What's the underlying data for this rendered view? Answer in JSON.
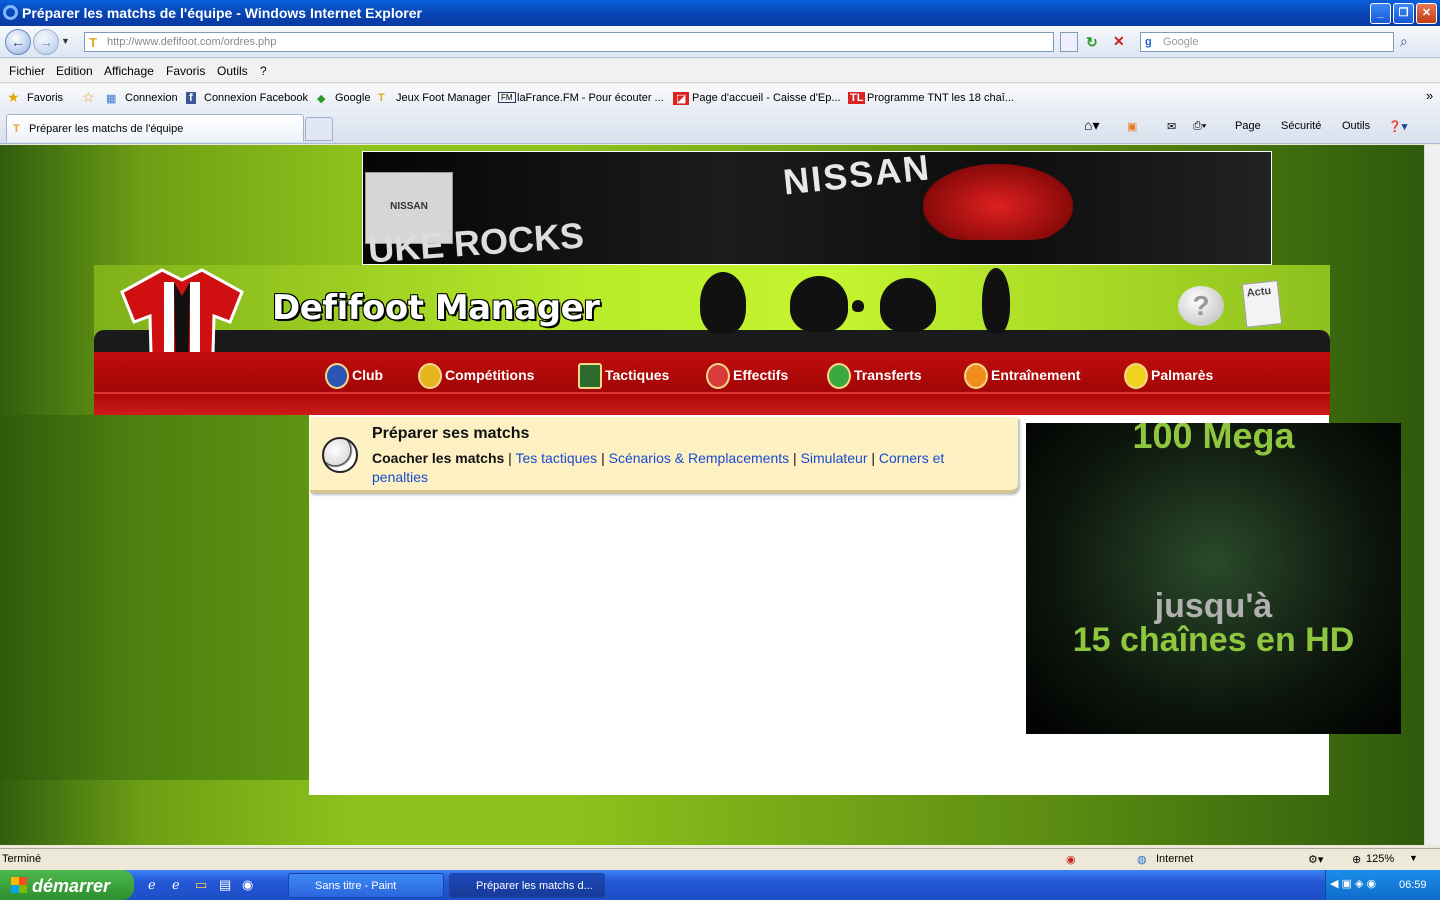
{
  "window": {
    "title": "Préparer les matchs de l'équipe - Windows Internet Explorer"
  },
  "browser": {
    "address": "http://www.defifoot.com/ordres.php",
    "search_placeholder": "Google",
    "menu": [
      "Fichier",
      "Edition",
      "Affichage",
      "Favoris",
      "Outils",
      "?"
    ],
    "favorites_label": "Favoris",
    "favorites": [
      "Connexion",
      "Connexion  Facebook",
      "Google",
      "Jeux Foot Manager",
      "laFrance.FM - Pour écouter ...",
      "Page d'accueil - Caisse d'Ep...",
      "Programme TNT  les 18 chaî..."
    ],
    "tab_title": "Préparer les matchs de l'équipe",
    "commands": [
      "Page",
      "Sécurité",
      "Outils"
    ]
  },
  "banner": {
    "brand": "NISSAN",
    "logo_text": "NISSAN",
    "slogan": "UKE ROCKS"
  },
  "site": {
    "logo_text": "Defifoot Manager",
    "actu_label": "Actu",
    "help_label": "?",
    "nav": [
      {
        "label": "Club",
        "color": "#2b55b5"
      },
      {
        "label": "Compétitions",
        "color": "#e6b51e"
      },
      {
        "label": "Tactiques",
        "color": "#2d6b2d"
      },
      {
        "label": "Effectifs",
        "color": "#d93a3a"
      },
      {
        "label": "Transferts",
        "color": "#3da83d"
      },
      {
        "label": "Entraînement",
        "color": "#f08c1e"
      },
      {
        "label": "Palmarès",
        "color": "#f0d21e"
      }
    ]
  },
  "subnav": {
    "title": "Préparer ses matchs",
    "current": "Coacher les matchs",
    "links": [
      "Tes tactiques",
      "Scénarios & Remplacements",
      "Simulateur",
      "Corners et penalties"
    ]
  },
  "ad": {
    "line1": "100 Mega",
    "line2": "jusqu'à",
    "line3": "15 chaînes en HD"
  },
  "status": {
    "text": "Terminé",
    "zone": "Internet",
    "zoom": "125%"
  },
  "taskbar": {
    "start": "démarrer",
    "tasks": [
      "Sans titre - Paint",
      "Préparer les matchs d..."
    ],
    "clock": "06:59"
  },
  "colors": {
    "accent_green": "#8dc21c",
    "nav_red": "#c20d0d",
    "link_blue": "#1a4bd0"
  }
}
